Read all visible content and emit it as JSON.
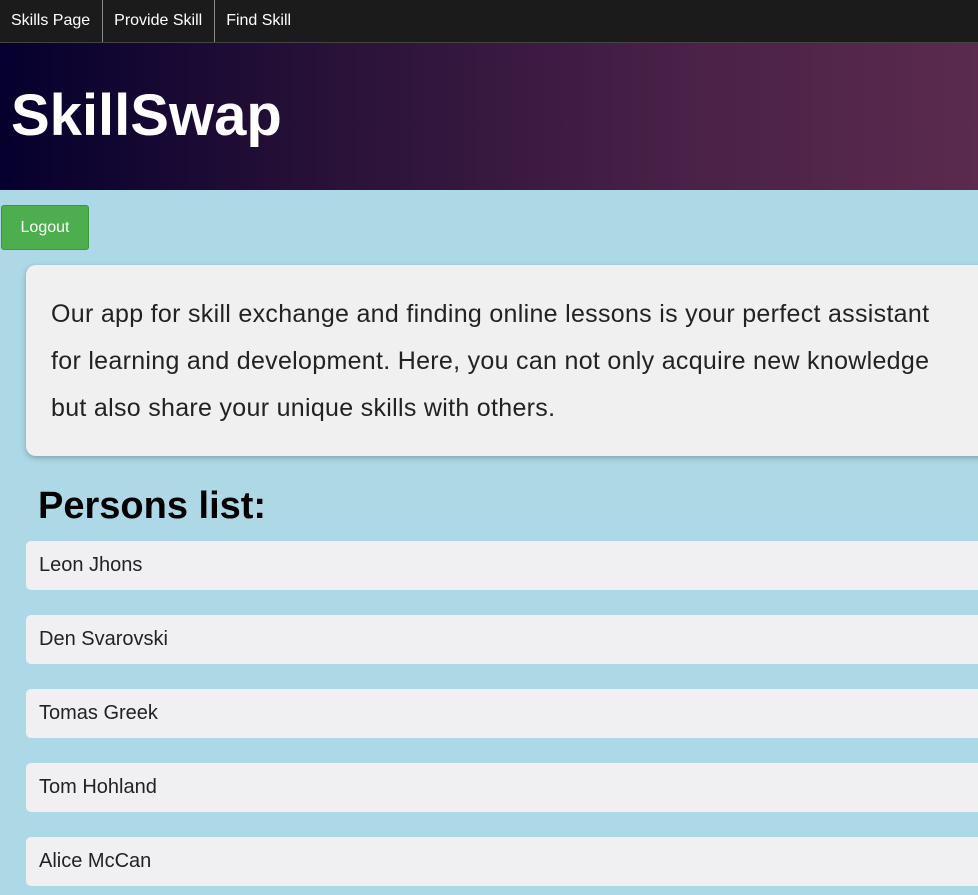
{
  "nav": {
    "items": [
      {
        "label": "Skills Page"
      },
      {
        "label": "Provide Skill"
      },
      {
        "label": "Find Skill"
      }
    ]
  },
  "header": {
    "title": "SkillSwap"
  },
  "auth": {
    "logout_label": "Logout"
  },
  "intro": {
    "text": "Our app for skill exchange and finding online lessons is your perfect assistant for learning and development. Here, you can not only acquire new knowledge but also share your unique skills with others."
  },
  "persons": {
    "title": "Persons list:",
    "items": [
      {
        "name": "Leon Jhons"
      },
      {
        "name": "Den Svarovski"
      },
      {
        "name": "Tomas Greek"
      },
      {
        "name": "Tom Hohland"
      },
      {
        "name": "Alice McCan"
      }
    ]
  }
}
